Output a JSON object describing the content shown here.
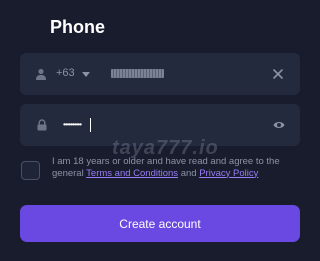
{
  "form": {
    "title": "Phone",
    "country_code": "+63",
    "phone_value_masked": "••••••••••",
    "password_value_masked": "••••••••••"
  },
  "agreement": {
    "prefix": "I am 18 years or older and have read and agree to the general",
    "terms_link": "Terms and Conditions",
    "connector": "and",
    "privacy_link": "Privacy Policy",
    "checked": false
  },
  "watermark": "taya777.io",
  "cta": {
    "label": "Create account"
  },
  "colors": {
    "background": "#191c2c",
    "field": "#242a3d",
    "accent": "#6949e2",
    "link": "#9a7cf6",
    "muted_text": "#8c92a6"
  },
  "icons": [
    "user-icon",
    "chevron-down-icon",
    "close-icon",
    "lock-icon",
    "eye-icon"
  ]
}
